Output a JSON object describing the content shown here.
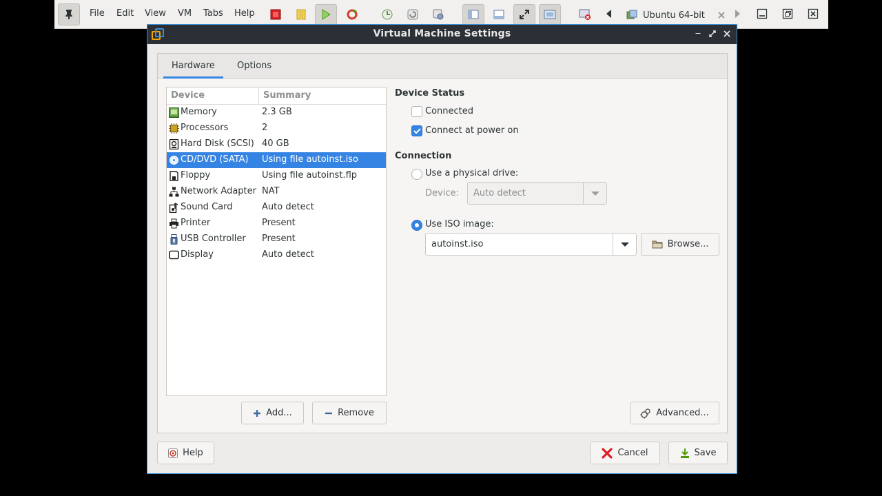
{
  "host": {
    "menu": [
      "File",
      "Edit",
      "View",
      "VM",
      "Tabs",
      "Help"
    ],
    "tab_label": "Ubuntu 64-bit"
  },
  "dialog": {
    "title": "Virtual Machine Settings",
    "tabs": [
      "Hardware",
      "Options"
    ],
    "active_tab": "Hardware",
    "list_headers": {
      "device": "Device",
      "summary": "Summary"
    },
    "devices": [
      {
        "name": "Memory",
        "summary": "2.3 GB",
        "icon": "memory-icon"
      },
      {
        "name": "Processors",
        "summary": "2",
        "icon": "processor-icon"
      },
      {
        "name": "Hard Disk (SCSI)",
        "summary": "40 GB",
        "icon": "hard-disk-icon"
      },
      {
        "name": "CD/DVD (SATA)",
        "summary": "Using file autoinst.iso",
        "icon": "cd-dvd-icon"
      },
      {
        "name": "Floppy",
        "summary": "Using file autoinst.flp",
        "icon": "floppy-icon"
      },
      {
        "name": "Network Adapter",
        "summary": "NAT",
        "icon": "network-icon"
      },
      {
        "name": "Sound Card",
        "summary": "Auto detect",
        "icon": "sound-icon"
      },
      {
        "name": "Printer",
        "summary": "Present",
        "icon": "printer-icon"
      },
      {
        "name": "USB Controller",
        "summary": "Present",
        "icon": "usb-icon"
      },
      {
        "name": "Display",
        "summary": "Auto detect",
        "icon": "display-icon"
      }
    ],
    "selected_device": "CD/DVD (SATA)",
    "add_label": "Add...",
    "remove_label": "Remove",
    "device_status": {
      "title": "Device Status",
      "connected_label": "Connected",
      "connected": false,
      "connect_power_label": "Connect at power on",
      "connect_power": true
    },
    "connection": {
      "title": "Connection",
      "physical_label": "Use a physical drive:",
      "device_label": "Device:",
      "device_value": "Auto detect",
      "iso_label": "Use ISO image:",
      "iso_value": "autoinst.iso",
      "browse_label": "Browse...",
      "selected": "iso"
    },
    "advanced_label": "Advanced...",
    "help_label": "Help",
    "cancel_label": "Cancel",
    "save_label": "Save"
  },
  "colors": {
    "accent": "#3584e4",
    "titlebar": "#2b3036",
    "dialog_bg": "#edeceb",
    "cancel_icon": "#e01b24",
    "save_icon": "#4e9a06"
  }
}
